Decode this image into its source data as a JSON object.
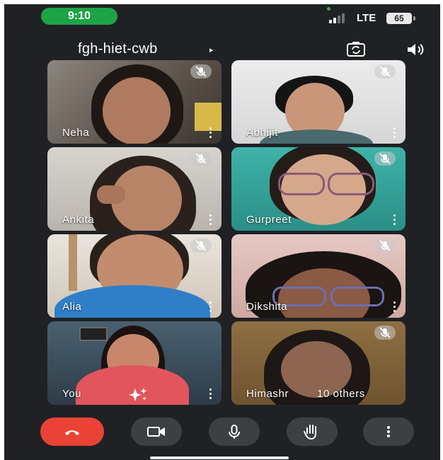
{
  "status_bar": {
    "time": "9:10",
    "network": "LTE",
    "battery": "65"
  },
  "header": {
    "meeting_code": "fgh-hiet-cwb",
    "caret": "▸"
  },
  "participants": [
    {
      "name": "Neha"
    },
    {
      "name": "Abhijit"
    },
    {
      "name": "Ankita"
    },
    {
      "name": "Gurpreet"
    },
    {
      "name": "Alia"
    },
    {
      "name": "Dikshita"
    },
    {
      "name": "You"
    },
    {
      "name": "Himashr"
    }
  ],
  "others_label": "10 others",
  "colors": {
    "background": "#202124",
    "end_call": "#ea4335",
    "control": "#3c4043",
    "time_pill": "#1ea446"
  },
  "controls": {
    "end_call_icon": "phone-hangup-icon",
    "camera_icon": "video-camera-icon",
    "mic_icon": "microphone-icon",
    "hand_icon": "raise-hand-icon",
    "more_icon": "more-vertical-icon"
  }
}
